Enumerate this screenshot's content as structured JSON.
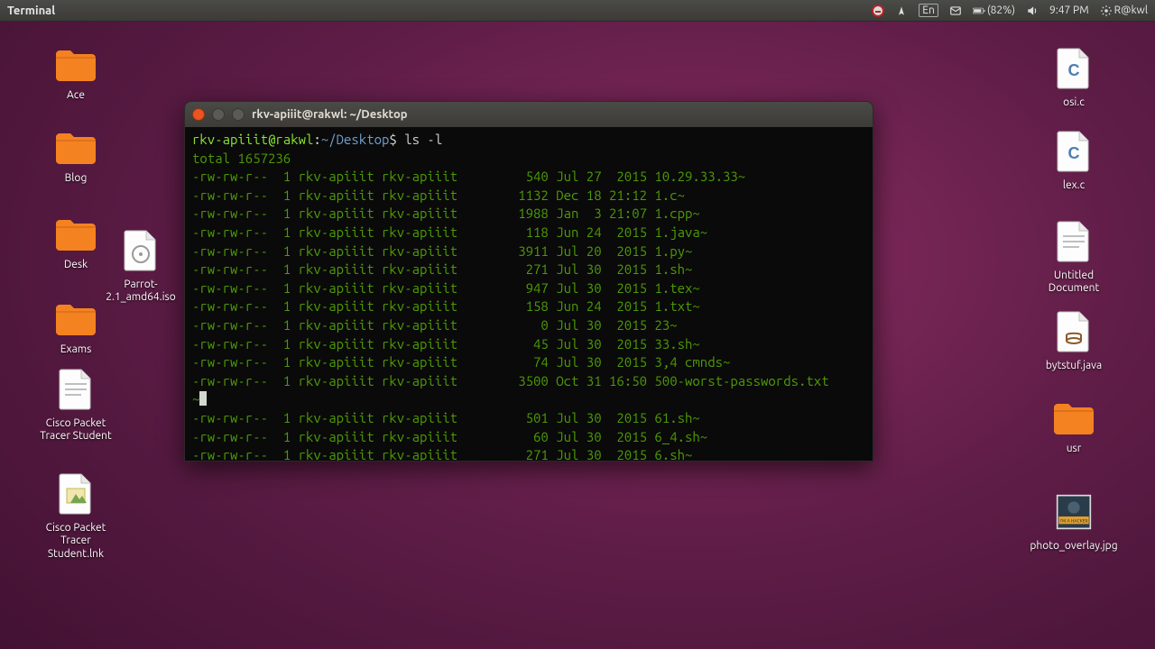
{
  "menubar": {
    "app": "Terminal",
    "battery": "(82%)",
    "time": "9:47 PM",
    "user": "R@kwl",
    "lang": "En"
  },
  "desktop": {
    "left": [
      {
        "name": "Ace",
        "kind": "folder"
      },
      {
        "name": "Blog",
        "kind": "folder"
      },
      {
        "name": "Desk",
        "kind": "folder"
      },
      {
        "name": "Exams",
        "kind": "folder"
      },
      {
        "name": "Cisco Packet Tracer Student",
        "kind": "doc"
      },
      {
        "name": "Cisco Packet Tracer Student.lnk",
        "kind": "link"
      }
    ],
    "left2": [
      {
        "name": "Parrot-2.1_amd64.iso",
        "kind": "iso"
      }
    ],
    "right": [
      {
        "name": "osi.c",
        "kind": "c"
      },
      {
        "name": "lex.c",
        "kind": "c"
      },
      {
        "name": "Untitled Document",
        "kind": "doc"
      },
      {
        "name": "bytstuf.java",
        "kind": "java"
      },
      {
        "name": "usr",
        "kind": "folder"
      },
      {
        "name": "photo_overlay.jpg",
        "kind": "image"
      }
    ]
  },
  "terminal": {
    "title": "rkv-apiiit@rakwl: ~/Desktop",
    "prompt_user": "rkv-apiiit@rakwl",
    "prompt_path": "~/Desktop",
    "command": "ls -l",
    "total_line": "total 1657236",
    "rows": [
      {
        "perm": "-rw-rw-r--",
        "links": "1",
        "owner": "rkv-apiiit",
        "group": "rkv-apiiit",
        "size": "540",
        "date": "Jul 27  2015",
        "name": "10.29.33.33~"
      },
      {
        "perm": "-rw-rw-r--",
        "links": "1",
        "owner": "rkv-apiiit",
        "group": "rkv-apiiit",
        "size": "1132",
        "date": "Dec 18 21:12",
        "name": "1.c~"
      },
      {
        "perm": "-rw-rw-r--",
        "links": "1",
        "owner": "rkv-apiiit",
        "group": "rkv-apiiit",
        "size": "1988",
        "date": "Jan  3 21:07",
        "name": "1.cpp~"
      },
      {
        "perm": "-rw-rw-r--",
        "links": "1",
        "owner": "rkv-apiiit",
        "group": "rkv-apiiit",
        "size": "118",
        "date": "Jun 24  2015",
        "name": "1.java~"
      },
      {
        "perm": "-rw-rw-r--",
        "links": "1",
        "owner": "rkv-apiiit",
        "group": "rkv-apiiit",
        "size": "3911",
        "date": "Jul 20  2015",
        "name": "1.py~"
      },
      {
        "perm": "-rw-rw-r--",
        "links": "1",
        "owner": "rkv-apiiit",
        "group": "rkv-apiiit",
        "size": "271",
        "date": "Jul 30  2015",
        "name": "1.sh~"
      },
      {
        "perm": "-rw-rw-r--",
        "links": "1",
        "owner": "rkv-apiiit",
        "group": "rkv-apiiit",
        "size": "947",
        "date": "Jul 30  2015",
        "name": "1.tex~"
      },
      {
        "perm": "-rw-rw-r--",
        "links": "1",
        "owner": "rkv-apiiit",
        "group": "rkv-apiiit",
        "size": "158",
        "date": "Jun 24  2015",
        "name": "1.txt~"
      },
      {
        "perm": "-rw-rw-r--",
        "links": "1",
        "owner": "rkv-apiiit",
        "group": "rkv-apiiit",
        "size": "0",
        "date": "Jul 30  2015",
        "name": "23~"
      },
      {
        "perm": "-rw-rw-r--",
        "links": "1",
        "owner": "rkv-apiiit",
        "group": "rkv-apiiit",
        "size": "45",
        "date": "Jul 30  2015",
        "name": "33.sh~"
      },
      {
        "perm": "-rw-rw-r--",
        "links": "1",
        "owner": "rkv-apiiit",
        "group": "rkv-apiiit",
        "size": "74",
        "date": "Jul 30  2015",
        "name": "3,4 cmnds~"
      },
      {
        "perm": "-rw-rw-r--",
        "links": "1",
        "owner": "rkv-apiiit",
        "group": "rkv-apiiit",
        "size": "3500",
        "date": "Oct 31 16:50",
        "name": "500-worst-passwords.txt~"
      },
      {
        "perm": "-rw-rw-r--",
        "links": "1",
        "owner": "rkv-apiiit",
        "group": "rkv-apiiit",
        "size": "501",
        "date": "Jul 30  2015",
        "name": "61.sh~"
      },
      {
        "perm": "-rw-rw-r--",
        "links": "1",
        "owner": "rkv-apiiit",
        "group": "rkv-apiiit",
        "size": "60",
        "date": "Jul 30  2015",
        "name": "6_4.sh~"
      },
      {
        "perm": "-rw-rw-r--",
        "links": "1",
        "owner": "rkv-apiiit",
        "group": "rkv-apiiit",
        "size": "271",
        "date": "Jul 30  2015",
        "name": "6.sh~"
      }
    ]
  }
}
